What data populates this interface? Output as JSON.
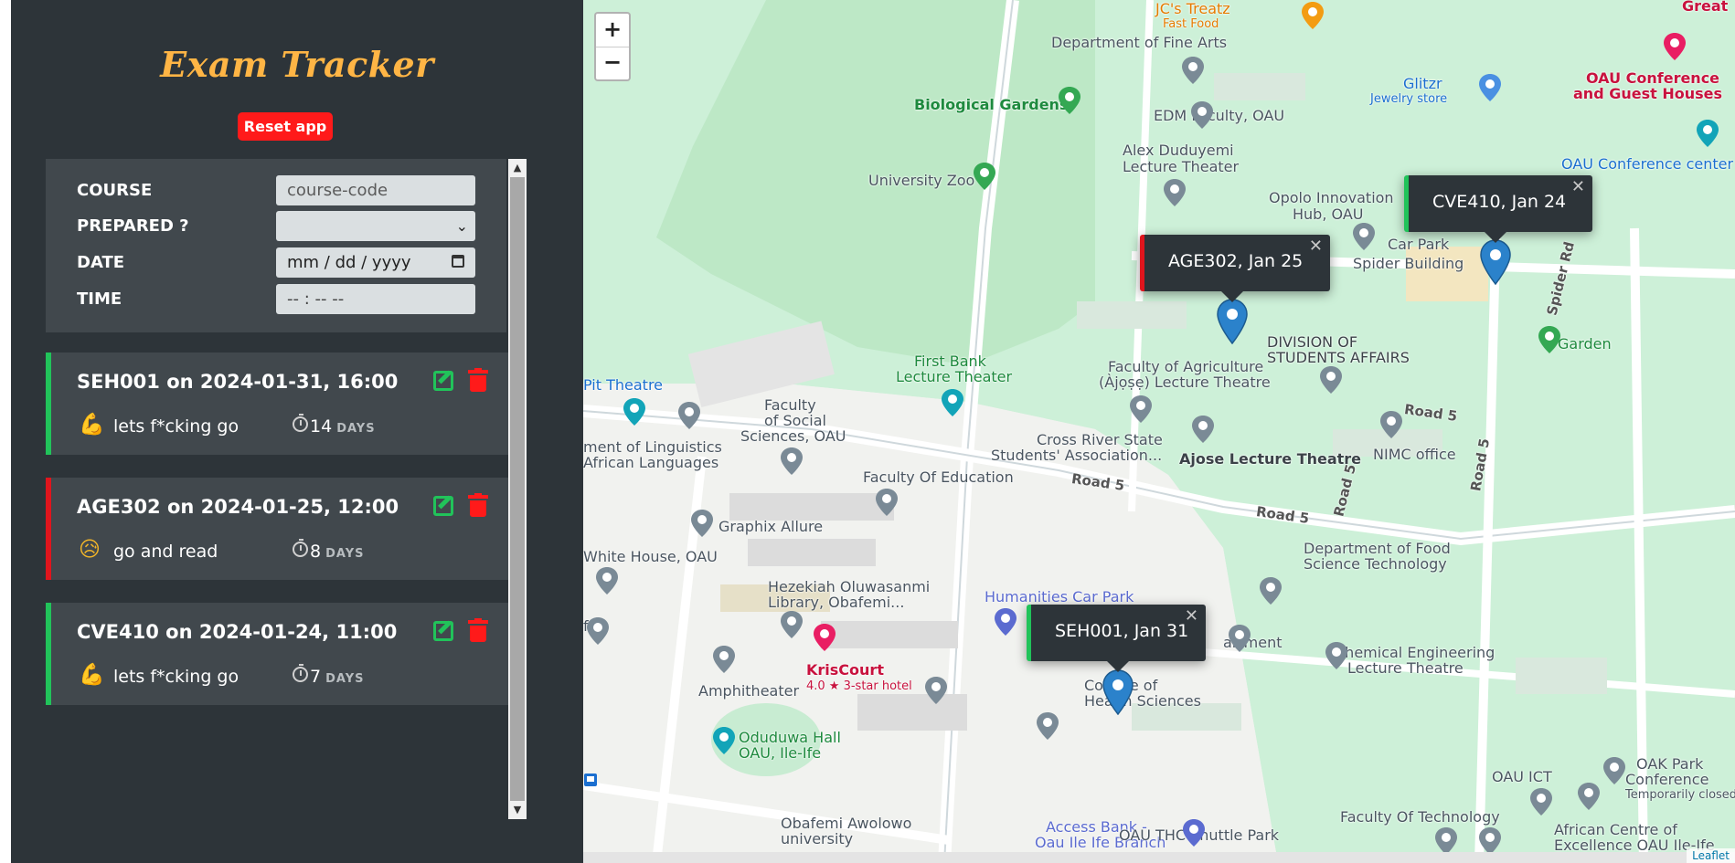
{
  "app": {
    "title": "Exam Tracker",
    "reset_label": "Reset app"
  },
  "form": {
    "course_label": "COURSE",
    "course_placeholder": "course-code",
    "prepared_label": "PREPARED ?",
    "prepared_value": "",
    "date_label": "DATE",
    "date_placeholder": "mm / dd / yyyy",
    "time_label": "TIME",
    "time_placeholder": "-- : --  --"
  },
  "exams": [
    {
      "title": "SEH001 on 2024-01-31, 16:00",
      "status_color": "#21c35a",
      "emoji": "💪",
      "status": "lets f*cking go",
      "days": "14",
      "days_label": "DAYS"
    },
    {
      "title": "AGE302 on 2024-01-25, 12:00",
      "status_color": "#e0151d",
      "emoji": "😥",
      "status": "go and read",
      "days": "8",
      "days_label": "DAYS"
    },
    {
      "title": "CVE410 on 2024-01-24, 11:00",
      "status_color": "#21c35a",
      "emoji": "💪",
      "status": "lets f*cking go",
      "days": "7",
      "days_label": "DAYS"
    }
  ],
  "map": {
    "zoom_in": "+",
    "zoom_out": "−",
    "attribution": "Leaflet",
    "popups": [
      {
        "label": "CVE410, Jan 24",
        "close": "✕"
      },
      {
        "label": "AGE302, Jan 25",
        "close": "✕"
      },
      {
        "label": "SEH001, Jan 31",
        "close": "✕"
      }
    ],
    "labels": {
      "jcs_treatz": "JC's Treatz",
      "fast_food": "Fast Food",
      "great": "Great",
      "dept_fine_arts": "Department of Fine Arts",
      "glitzr": "Glitzr",
      "jewelry_store": "Jewelry store",
      "oau_conf_1": "OAU Conference",
      "oau_conf_2": "and Guest Houses",
      "biological_gardens": "Biological Gardens",
      "edm_faculty": "EDM Faculty, OAU",
      "oau_conf_center": "OAU Conference center",
      "alex_1": "Alex Duduyemi",
      "alex_2": "Lecture Theater",
      "university_zoo": "University Zoo",
      "opolo_1": "Opolo Innovation",
      "opolo_2": "Hub, OAU",
      "car_park": "Car Park",
      "spider_building": "Spider Building",
      "spider_rd": "Spider Rd",
      "division_1": "DIVISION OF",
      "division_2": "STUDENTS AFFAIRS",
      "garden": "Garden",
      "first_bank_1": "First Bank",
      "first_bank_2": "Lecture Theater",
      "faculty_agric_1": "Faculty of Agriculture",
      "faculty_agric_2": "(Àjọṣẹ) Lecture Theatre",
      "pit_theatre": "Pit Theatre",
      "fss_1": "Faculty",
      "fss_2": "of Social",
      "fss_3": "Sciences, OAU",
      "ling_1": "ment of Linguistics",
      "ling_2": "African Languages",
      "cross_river_1": "Cross River State",
      "cross_river_2": "Students' Association...",
      "ajose": "Ajose Lecture Theatre",
      "nimc": "NIMC office",
      "road5_a": "Road 5",
      "road5_b": "Road 5",
      "road5_c": "Road 5",
      "road5_d": "Road 5",
      "road5_e": "Road 5",
      "faculty_education": "Faculty Of Education",
      "graphix": "Graphix Allure",
      "white_house": "White House, OAU",
      "dept_food_1": "Department of Food",
      "dept_food_2": "Science Technology",
      "hezekiah_1": "Hezekiah Oluwasanmi",
      "hezekiah_2": "Library, Obafemi...",
      "humanities_cp": "Humanities Car Park",
      "department_partial": "artment",
      "chem_eng_1": "Chemical Engineering",
      "chem_eng_2": "Lecture Theatre",
      "kriscourt": "KrisCourt",
      "kriscourt_rating": "4.0 ★ 3-star hotel",
      "amphitheater": "Amphitheater",
      "college_health_1": "College of",
      "college_health_2": "Health Sciences",
      "oduduwa_1": "Oduduwa Hall",
      "oduduwa_2": "OAU, Ile-Ife",
      "oak_park_1": "OAK Park",
      "oak_park_2": "Conference",
      "oak_park_3": "Temporarily closed",
      "oau_ict": "OAU ICT",
      "obafemi_1": "Obafemi Awolowo",
      "obafemi_2": "university",
      "faculty_tech": "Faculty Of Technology",
      "access_bank_1": "Access Bank -",
      "access_bank_2": "Oau Ile Ife Branch",
      "oau_thc": "OAU THC Shuttle Park",
      "african_centre_1": "African Centre of",
      "african_centre_2": "Excellence OAU Ile-Ife",
      "f_partial": "f"
    }
  }
}
